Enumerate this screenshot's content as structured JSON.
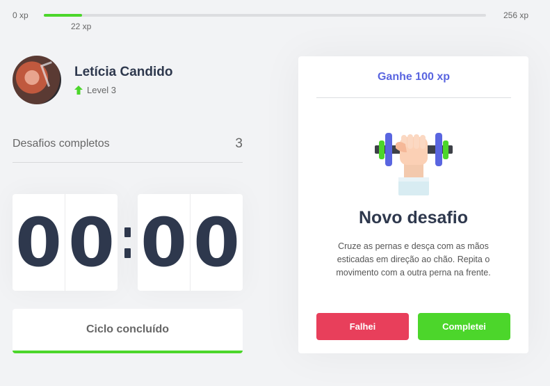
{
  "xp": {
    "min_label": "0 xp",
    "max_label": "256 xp",
    "current_label": "22 xp",
    "progress_fraction": 0.0859
  },
  "profile": {
    "name": "Letícia Candido",
    "level_label": "Level 3"
  },
  "stats": {
    "completed_label": "Desafios completos",
    "completed_value": "3"
  },
  "countdown": {
    "minute_left": "0",
    "minute_right": "0",
    "second_left": "0",
    "second_right": "0"
  },
  "cycle_button": {
    "label": "Ciclo concluído",
    "accent": "#4cd62b"
  },
  "challenge": {
    "reward_label": "Ganhe 100 xp",
    "title": "Novo desafio",
    "description": "Cruze as pernas e desça com as mãos esticadas em direção ao chão. Repita o movimento com a outra perna na frente.",
    "icon": "dumbbell-icon",
    "fail_label": "Falhei",
    "success_label": "Completei"
  },
  "colors": {
    "green": "#4cd62b",
    "red": "#e83f5b",
    "blue": "#5965e0",
    "title": "#2e384d",
    "background": "#f2f3f5"
  }
}
